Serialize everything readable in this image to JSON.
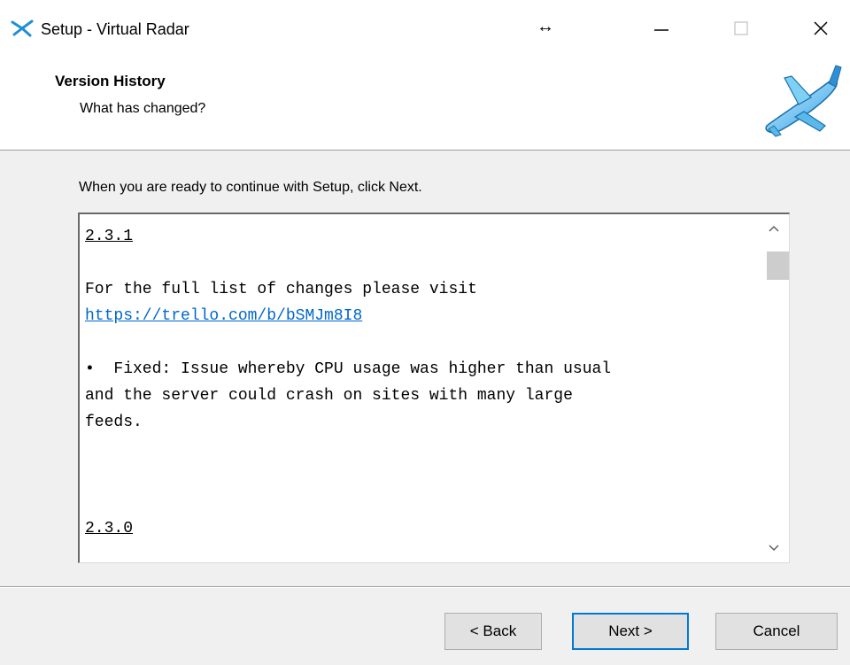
{
  "window": {
    "title": "Setup - Virtual Radar",
    "move_glyph": "↔",
    "controls": [
      "minimize-icon",
      "maximize-icon",
      "close-icon"
    ]
  },
  "header": {
    "title": "Version History",
    "subtitle": "What has changed?",
    "image": "airplane-icon"
  },
  "body": {
    "instruction": "When you are ready to continue with Setup, click Next."
  },
  "memo": {
    "entries": [
      {
        "version": "2.3.1",
        "intro_line1": "For the full list of changes please visit",
        "link": "https://trello.com/b/bSMJm8I8",
        "bullet_line1": "•  Fixed: Issue whereby CPU usage was higher than usual",
        "bullet_line2": "and the server could crash on sites with many large",
        "bullet_line3": "feeds."
      },
      {
        "version": "2.3.0"
      }
    ]
  },
  "buttons": {
    "back": "< Back",
    "next": "Next >",
    "cancel": "Cancel"
  },
  "colors": {
    "link": "#0066cc",
    "default_button_border": "#0078d7"
  }
}
